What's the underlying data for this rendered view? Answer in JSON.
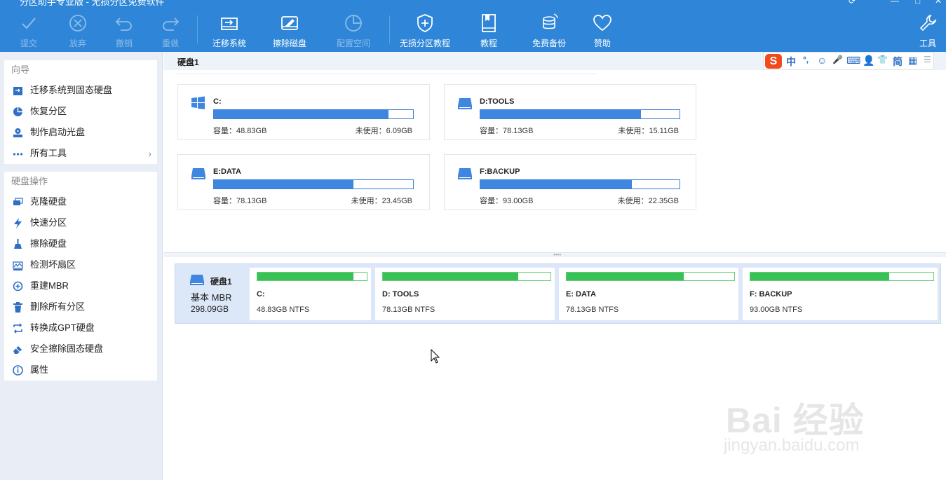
{
  "app": {
    "title": "分区助手专业版 - 无损分区免费软件"
  },
  "toolbar": {
    "items": [
      {
        "label": "提交",
        "icon": "check-icon",
        "enabled": false
      },
      {
        "label": "放弃",
        "icon": "discard-icon",
        "enabled": false
      },
      {
        "label": "撤销",
        "icon": "undo-icon",
        "enabled": false
      },
      {
        "label": "重做",
        "icon": "redo-icon",
        "enabled": false
      },
      {
        "label": "迁移系统",
        "icon": "migrate-os-icon",
        "enabled": true
      },
      {
        "label": "擦除磁盘",
        "icon": "wipe-disk-icon",
        "enabled": true
      },
      {
        "label": "配置空间",
        "icon": "pie-chart-icon",
        "enabled": false
      },
      {
        "label": "无损分区教程",
        "icon": "shield-plus-icon",
        "enabled": true
      },
      {
        "label": "教程",
        "icon": "book-icon",
        "enabled": true
      },
      {
        "label": "免费备份",
        "icon": "backup-database-icon",
        "enabled": true
      },
      {
        "label": "赞助",
        "icon": "heart-icon",
        "enabled": true
      },
      {
        "label": "工具",
        "icon": "wrench-icon",
        "enabled": true
      }
    ]
  },
  "sidebar": {
    "guide_title": "向导",
    "guide_items": [
      {
        "label": "迁移系统到固态硬盘",
        "icon": "migrate-ssd-icon"
      },
      {
        "label": "恢复分区",
        "icon": "pie-restore-icon"
      },
      {
        "label": "制作启动光盘",
        "icon": "bootable-media-icon"
      },
      {
        "label": "所有工具",
        "icon": "more-dots-icon"
      }
    ],
    "disk_ops_title": "硬盘操作",
    "disk_ops_items": [
      {
        "label": "克隆硬盘",
        "icon": "clone-disk-icon"
      },
      {
        "label": "快速分区",
        "icon": "lightning-icon"
      },
      {
        "label": "擦除硬盘",
        "icon": "broom-icon"
      },
      {
        "label": "检测坏扇区",
        "icon": "bad-sector-icon"
      },
      {
        "label": "重建MBR",
        "icon": "rebuild-mbr-icon"
      },
      {
        "label": "删除所有分区",
        "icon": "trash-icon"
      },
      {
        "label": "转换成GPT硬盘",
        "icon": "convert-icon"
      },
      {
        "label": "安全擦除固态硬盘",
        "icon": "eraser-icon"
      },
      {
        "label": "属性",
        "icon": "info-icon"
      }
    ]
  },
  "disk": {
    "title": "硬盘1",
    "type": "基本 MBR",
    "size": "298.09GB",
    "partitions": [
      {
        "name": "C:",
        "capacity": "容量：48.83GB",
        "free": "未使用：6.09GB",
        "used_fraction": 0.875,
        "map_name": "C:",
        "map_info": "48.83GB NTFS",
        "icon": "windows-icon"
      },
      {
        "name": "D:TOOLS",
        "capacity": "容量：78.13GB",
        "free": "未使用：15.11GB",
        "used_fraction": 0.807,
        "map_name": "D: TOOLS",
        "map_info": "78.13GB NTFS",
        "icon": "drive-icon"
      },
      {
        "name": "E:DATA",
        "capacity": "容量：78.13GB",
        "free": "未使用：23.45GB",
        "used_fraction": 0.7,
        "map_name": "E: DATA",
        "map_info": "78.13GB NTFS",
        "icon": "drive-icon"
      },
      {
        "name": "F:BACKUP",
        "capacity": "容量：93.00GB",
        "free": "未使用：22.35GB",
        "used_fraction": 0.76,
        "map_name": "F: BACKUP",
        "map_info": "93.00GB NTFS",
        "icon": "drive-icon"
      }
    ]
  },
  "ime": {
    "logo": "S",
    "items": [
      "中",
      "°,",
      "☺",
      "🎤",
      "⌨",
      "👕",
      "简",
      "▦"
    ]
  },
  "watermark": {
    "line1": "Bai 经验",
    "line2": "jingyan.baidu.com"
  },
  "colors": {
    "toolbar_bg": "#2f86d8",
    "bar_blue": "#3e86e0",
    "bar_green": "#39c158"
  }
}
